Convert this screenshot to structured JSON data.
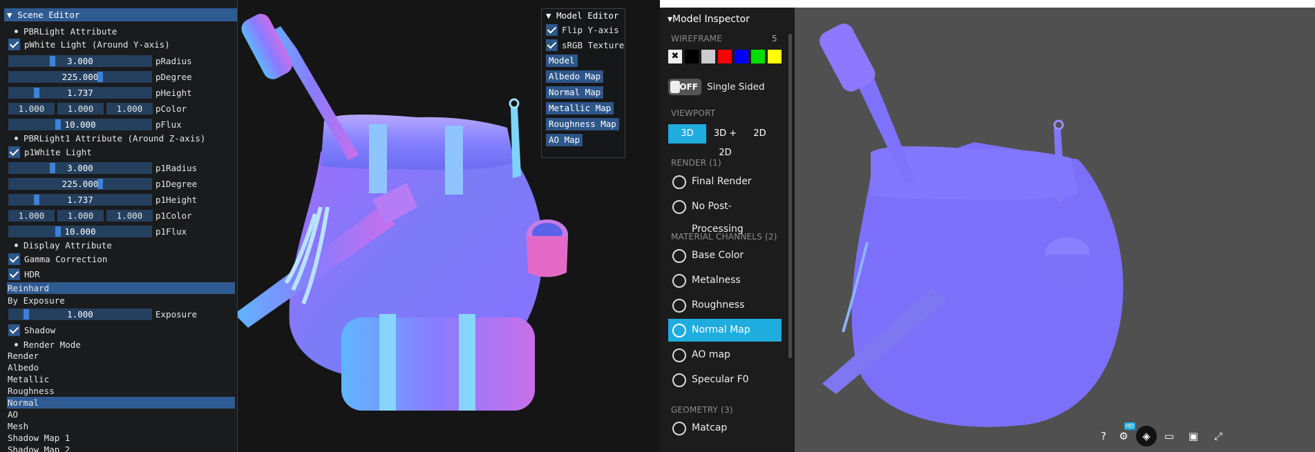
{
  "scene_editor": {
    "title": "Scene Editor",
    "pbr_light_header": "PBRLight Attribute",
    "white_light_label": "pWhite Light (Around Y-axis)",
    "radius": {
      "value": "3.000",
      "label": "pRadius"
    },
    "degree": {
      "value": "225.000",
      "label": "pDegree"
    },
    "height": {
      "value": "1.737",
      "label": "pHeight"
    },
    "color": {
      "r": "1.000",
      "g": "1.000",
      "b": "1.000",
      "label": "pColor"
    },
    "flux": {
      "value": "10.000",
      "label": "pFlux"
    },
    "pbr_light1_header": "PBRLight1 Attribute (Around Z-axis)",
    "white_light1_label": "p1White Light",
    "radius1": {
      "value": "3.000",
      "label": "p1Radius"
    },
    "degree1": {
      "value": "225.000",
      "label": "p1Degree"
    },
    "height1": {
      "value": "1.737",
      "label": "p1Height"
    },
    "color1": {
      "r": "1.000",
      "g": "1.000",
      "b": "1.000",
      "label": "p1Color"
    },
    "flux1": {
      "value": "10.000",
      "label": "p1Flux"
    },
    "display_header": "Display Attribute",
    "gamma_label": "Gamma Correction",
    "hdr_label": "HDR",
    "tonemap_options": [
      "Reinhard",
      "By Exposure"
    ],
    "tonemap_selected": "Reinhard",
    "exposure": {
      "value": "1.000",
      "label": "Exposure"
    },
    "shadow_label": "Shadow",
    "render_mode_header": "Render Mode",
    "render_modes": [
      "Render",
      "Albedo",
      "Metallic",
      "Roughness",
      "Normal",
      "AO",
      "Mesh",
      "Shadow Map 1",
      "Shadow Map 2"
    ],
    "render_mode_selected": "Normal"
  },
  "model_editor": {
    "title": "Model Editor",
    "flip_y_label": "Flip Y-axis",
    "srgb_label": "sRGB Texture",
    "buttons": [
      "Model",
      "Albedo Map",
      "Normal Map",
      "Metallic Map",
      "Roughness Map",
      "AO Map"
    ]
  },
  "model_inspector": {
    "title": "Model Inspector",
    "wireframe_label": "WIREFRAME",
    "wireframe_value": "5",
    "wire_colors": [
      "#000000",
      "#cccccc",
      "#ff0000",
      "#0000ff",
      "#00dd00",
      "#ffff00"
    ],
    "toggle_label": "OFF",
    "single_sided_label": "Single Sided",
    "viewport_label": "VIEWPORT",
    "viewport_modes": [
      "3D",
      "3D + 2D",
      "2D"
    ],
    "viewport_selected": "3D",
    "render_label": "RENDER (1)",
    "render_items": [
      "Final Render",
      "No Post-Processing"
    ],
    "material_label": "MATERIAL CHANNELS (2)",
    "material_items": [
      "Base Color",
      "Metalness",
      "Roughness",
      "Normal Map",
      "AO map",
      "Specular F0"
    ],
    "material_selected": "Normal Map",
    "geometry_label": "GEOMETRY (3)",
    "geometry_items": [
      "Matcap"
    ],
    "accent": "#1faddf"
  },
  "viewer_toolbar": {
    "hd_badge": "HD",
    "help_label": "?"
  }
}
